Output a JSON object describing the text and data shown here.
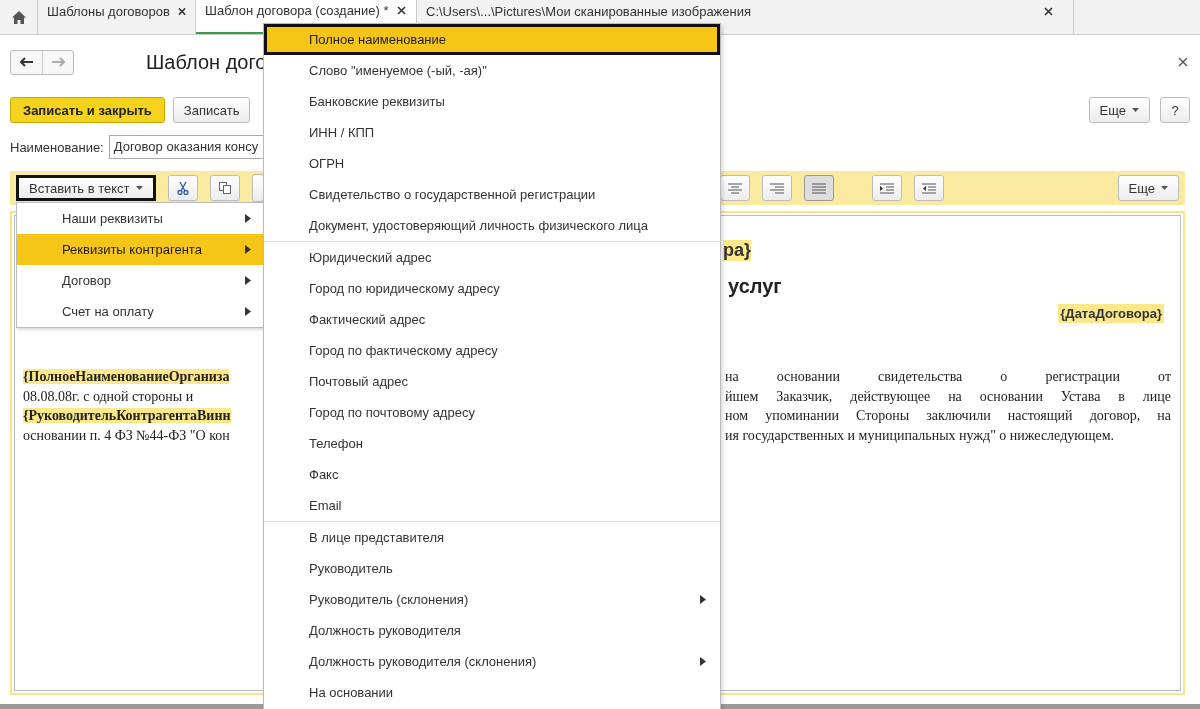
{
  "tabs": [
    {
      "label": "Шаблоны договоров",
      "selected": false
    },
    {
      "label": "Шаблон договора (создание) *",
      "selected": true
    },
    {
      "label": "C:\\Users\\...\\Pictures\\Мои сканированные изображения",
      "selected": false
    }
  ],
  "header": {
    "title": "Шаблон дого"
  },
  "actions": {
    "primary": "Записать и закрыть",
    "secondary": "Записать",
    "more": "Еще",
    "help": "?"
  },
  "name_field": {
    "label": "Наименование:",
    "value": "Договор оказания консу"
  },
  "format_toolbar": {
    "insert_button": "Вставить в текст",
    "more": "Еще",
    "align": [
      {
        "kind": "center",
        "selected": false
      },
      {
        "kind": "right",
        "selected": false
      },
      {
        "kind": "justify",
        "selected": true
      }
    ]
  },
  "document": {
    "heading_end": "ра}",
    "title_end": "услуг",
    "date_field": "{ДатаДоговора}",
    "lines": [
      {
        "left": "{ПолноеНаименованиеОрганиза",
        "left_field": true,
        "right": "на основании свидетельства о регистрации от",
        "last": false
      },
      {
        "left": "08.08.08г. с одной стороны и",
        "left_field": false,
        "right": "йшем Заказчик, действующее на основании Устава в лице",
        "last": false
      },
      {
        "left": "{РуководительКонтрагентаВинн",
        "left_field": true,
        "right": "ном упоминании Стороны заключили настоящий договор, на",
        "last": false
      },
      {
        "left": "основании п. 4 ФЗ №44-ФЗ \"О кон",
        "left_field": false,
        "right": "ия государственных и муниципальных нужд\" о нижеследующем.",
        "last": true
      }
    ]
  },
  "insert_menu": [
    {
      "label": "Наши реквизиты",
      "selected": false
    },
    {
      "label": "Реквизиты контрагента",
      "selected": true
    },
    {
      "label": "Договор",
      "selected": false
    },
    {
      "label": "Счет на оплату",
      "selected": false
    }
  ],
  "submenu": {
    "groups": [
      [
        {
          "label": "Полное наименование",
          "selected": true,
          "has_submenu": false
        },
        {
          "label": "Слово \"именуемое (-ый, -ая)\"",
          "selected": false,
          "has_submenu": false
        },
        {
          "label": "Банковские реквизиты",
          "selected": false,
          "has_submenu": false
        },
        {
          "label": "ИНН / КПП",
          "selected": false,
          "has_submenu": false
        },
        {
          "label": "ОГРН",
          "selected": false,
          "has_submenu": false
        },
        {
          "label": "Свидетельство о государственной регистрации",
          "selected": false,
          "has_submenu": false
        },
        {
          "label": "Документ, удостоверяющий личность физического лица",
          "selected": false,
          "has_submenu": false
        }
      ],
      [
        {
          "label": "Юридический адрес",
          "selected": false,
          "has_submenu": false
        },
        {
          "label": "Город по юридическому адресу",
          "selected": false,
          "has_submenu": false
        },
        {
          "label": "Фактический адрес",
          "selected": false,
          "has_submenu": false
        },
        {
          "label": "Город по фактическому адресу",
          "selected": false,
          "has_submenu": false
        },
        {
          "label": "Почтовый адрес",
          "selected": false,
          "has_submenu": false
        },
        {
          "label": "Город по почтовому адресу",
          "selected": false,
          "has_submenu": false
        },
        {
          "label": "Телефон",
          "selected": false,
          "has_submenu": false
        },
        {
          "label": "Факс",
          "selected": false,
          "has_submenu": false
        },
        {
          "label": "Email",
          "selected": false,
          "has_submenu": false
        }
      ],
      [
        {
          "label": "В лице представителя",
          "selected": false,
          "has_submenu": false
        },
        {
          "label": "Руководитель",
          "selected": false,
          "has_submenu": false
        },
        {
          "label": "Руководитель (склонения)",
          "selected": false,
          "has_submenu": true
        },
        {
          "label": "Должность руководителя",
          "selected": false,
          "has_submenu": false
        },
        {
          "label": "Должность руководителя (склонения)",
          "selected": false,
          "has_submenu": true
        },
        {
          "label": "На основании",
          "selected": false,
          "has_submenu": false
        }
      ]
    ]
  }
}
